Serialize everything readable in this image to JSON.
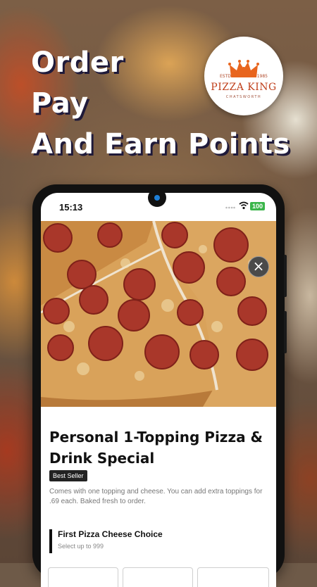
{
  "headline": [
    "Order",
    "Pay",
    "And Earn Points"
  ],
  "logo": {
    "brand": "PIZZA KING",
    "estd": "ESTD",
    "year": "1985",
    "location": "CHATSWORTH",
    "crown_color": "#e8651e"
  },
  "status_bar": {
    "time": "15:13",
    "battery": "100",
    "battery_color": "#3ab54a"
  },
  "product": {
    "title": "Personal 1-Topping Pizza & Drink Special",
    "badge": "Best Seller",
    "description": "Comes with one topping and cheese. You can add extra toppings for .69 each. Baked fresh to order.",
    "close_icon": "close-icon"
  },
  "option_group": {
    "title": "First Pizza Cheese Choice",
    "subtitle": "Select up to 999"
  }
}
